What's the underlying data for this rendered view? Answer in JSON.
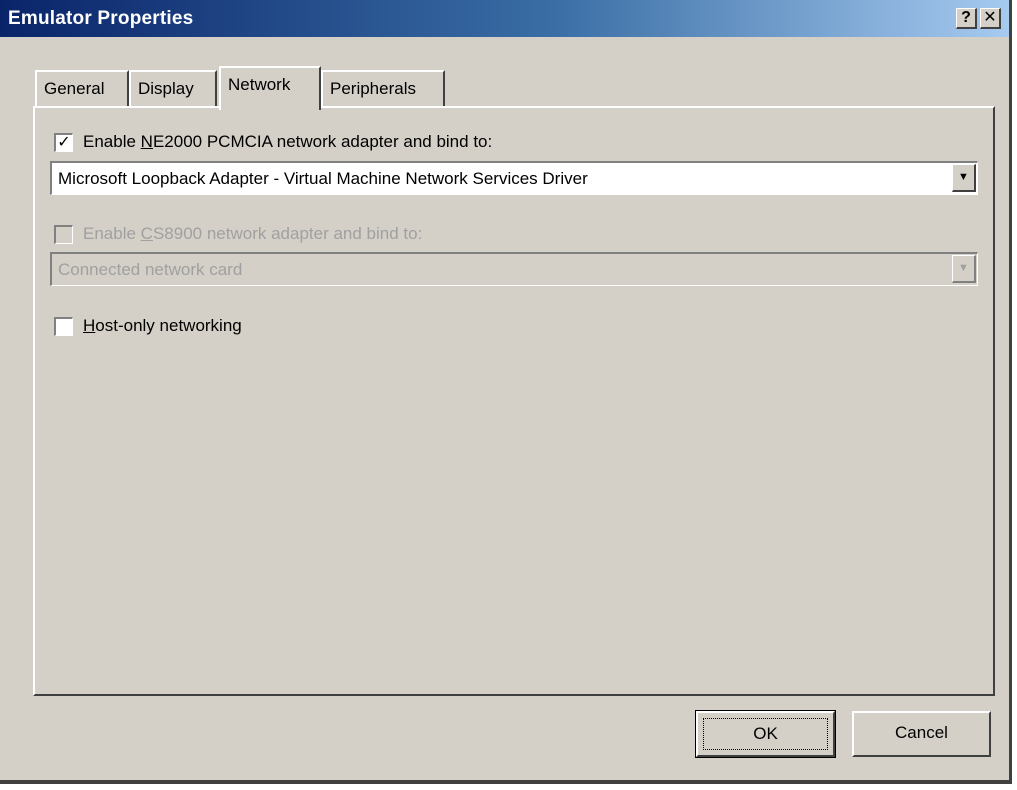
{
  "window": {
    "title": "Emulator Properties",
    "help_button": "?",
    "close_button": "✕"
  },
  "tabs": [
    {
      "label": "General",
      "selected": false
    },
    {
      "label": "Display",
      "selected": false
    },
    {
      "label": "Network",
      "selected": true
    },
    {
      "label": "Peripherals",
      "selected": false
    }
  ],
  "network": {
    "ne2000": {
      "label_pre": "Enable ",
      "label_accel": "N",
      "label_post": "E2000 PCMCIA network adapter and bind to:",
      "checked": true,
      "check_mark": "✓",
      "selected_adapter": "Microsoft Loopback Adapter - Virtual Machine Network Services Driver"
    },
    "cs8900": {
      "label_pre": "Enable ",
      "label_accel": "C",
      "label_post": "S8900 network adapter and bind to:",
      "checked": false,
      "enabled": false,
      "selected_adapter": "Connected network card"
    },
    "host_only": {
      "label_accel": "H",
      "label_post": "ost-only networking",
      "checked": false
    },
    "dropdown_arrow": "▼"
  },
  "buttons": {
    "ok": "OK",
    "cancel": "Cancel"
  }
}
